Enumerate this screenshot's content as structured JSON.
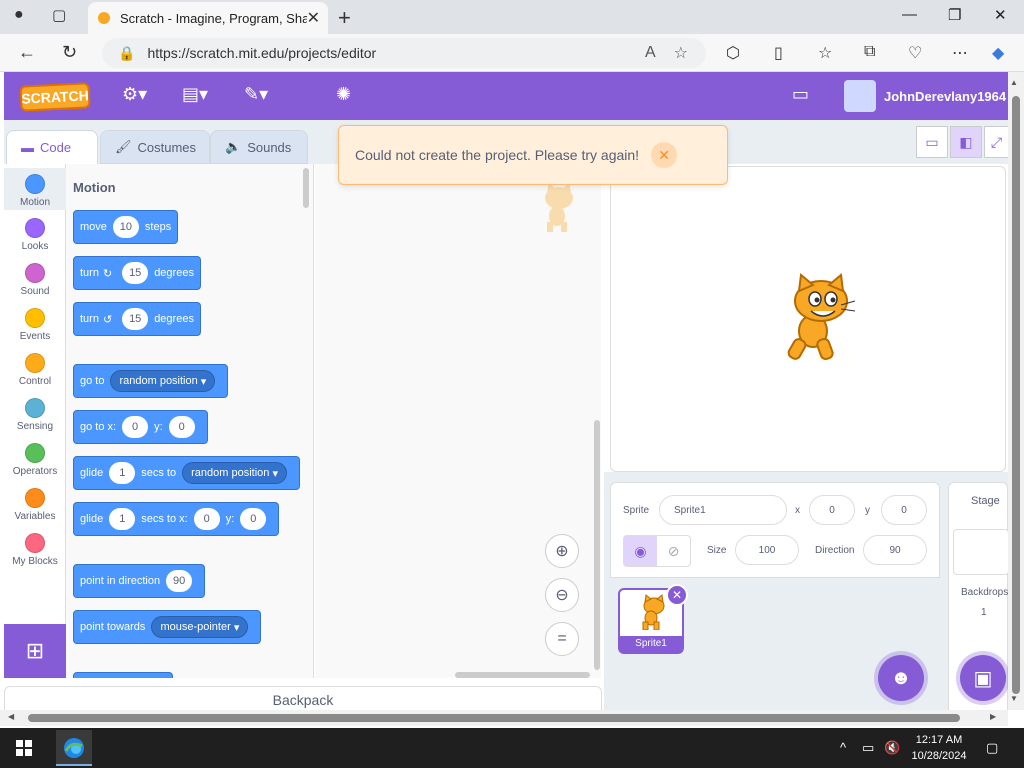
{
  "browser": {
    "tab_title": "Scratch - Imagine, Program, Share",
    "url": "https://scratch.mit.edu/projects/editor"
  },
  "menubar": {
    "logo_text": "SCRATCH",
    "username": "JohnDerevlany1964"
  },
  "editor_tabs": [
    "Code",
    "Costumes",
    "Sounds"
  ],
  "categories": [
    {
      "label": "Motion",
      "color": "#4c97ff"
    },
    {
      "label": "Looks",
      "color": "#9966ff"
    },
    {
      "label": "Sound",
      "color": "#cf63cf"
    },
    {
      "label": "Events",
      "color": "#ffbf00"
    },
    {
      "label": "Control",
      "color": "#ffab19"
    },
    {
      "label": "Sensing",
      "color": "#5cb1d6"
    },
    {
      "label": "Operators",
      "color": "#59c059"
    },
    {
      "label": "Variables",
      "color": "#ff8c1a"
    },
    {
      "label": "My Blocks",
      "color": "#ff6680"
    }
  ],
  "palette": {
    "heading": "Motion",
    "blocks": {
      "move": {
        "pre": "move",
        "val": "10",
        "post": "steps"
      },
      "turn_right": {
        "pre": "turn",
        "val": "15",
        "post": "degrees"
      },
      "turn_left": {
        "pre": "turn",
        "val": "15",
        "post": "degrees"
      },
      "goto": {
        "pre": "go to",
        "dd": "random position"
      },
      "gotoxy": {
        "pre": "go to x:",
        "x": "0",
        "ylbl": "y:",
        "y": "0"
      },
      "glide": {
        "pre": "glide",
        "val": "1",
        "mid": "secs to",
        "dd": "random position"
      },
      "glidexy": {
        "pre": "glide",
        "val": "1",
        "mid": "secs to x:",
        "x": "0",
        "ylbl": "y:",
        "y": "0"
      },
      "direction": {
        "pre": "point in direction",
        "val": "90"
      },
      "towards": {
        "pre": "point towards",
        "dd": "mouse-pointer"
      }
    }
  },
  "backpack_label": "Backpack",
  "alert": {
    "message": "Could not create the project. Please try again!"
  },
  "sprite_info": {
    "sprite_label": "Sprite",
    "sprite_name": "Sprite1",
    "x_label": "x",
    "x": "0",
    "y_label": "y",
    "y": "0",
    "show_label": "Show",
    "size_label": "Size",
    "size": "100",
    "direction_label": "Direction",
    "direction": "90"
  },
  "sprite_tile_name": "Sprite1",
  "stage_panel": {
    "title": "Stage",
    "backdrops_label": "Backdrops",
    "backdrops_count": "1"
  },
  "taskbar": {
    "time": "12:17 AM",
    "date": "10/28/2024"
  }
}
